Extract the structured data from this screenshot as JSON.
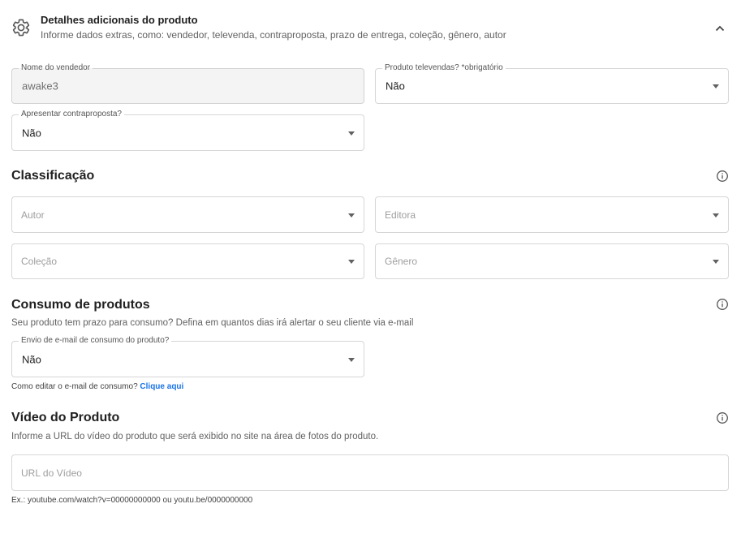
{
  "header": {
    "icon": "gear-icon",
    "title": "Detalhes adicionais do produto",
    "subtitle": "Informe dados extras, como: vendedor, televenda, contraproposta, prazo de entrega, coleção, gênero, autor",
    "collapse_icon": "chevron-up-icon"
  },
  "details": {
    "seller": {
      "label": "Nome do vendedor",
      "value": "awake3"
    },
    "telesales": {
      "label": "Produto televendas? *obrigatório",
      "value": "Não"
    },
    "counteroffer": {
      "label": "Apresentar contraproposta?",
      "value": "Não"
    }
  },
  "classification": {
    "title": "Classificação",
    "author": {
      "placeholder": "Autor"
    },
    "publisher": {
      "placeholder": "Editora"
    },
    "collection": {
      "placeholder": "Coleção"
    },
    "genre": {
      "placeholder": "Gênero"
    }
  },
  "consumption": {
    "title": "Consumo de produtos",
    "description": "Seu produto tem prazo para consumo? Defina em quantos dias irá alertar o seu cliente via e-mail",
    "email": {
      "label": "Envio de e-mail de consumo do produto?",
      "value": "Não"
    },
    "help_text": "Como editar o e-mail de consumo?",
    "help_link": "Clique aqui"
  },
  "video": {
    "title": "Vídeo do Produto",
    "description": "Informe a URL do vídeo do produto que será exibido no site na área de fotos do produto.",
    "url": {
      "placeholder": "URL do Vídeo",
      "value": ""
    },
    "example": "Ex.: youtube.com/watch?v=00000000000 ou youtu.be/0000000000"
  },
  "colors": {
    "link": "#1a73e8",
    "border": "#d6d6d6",
    "disabled_bg": "#f4f4f4"
  }
}
